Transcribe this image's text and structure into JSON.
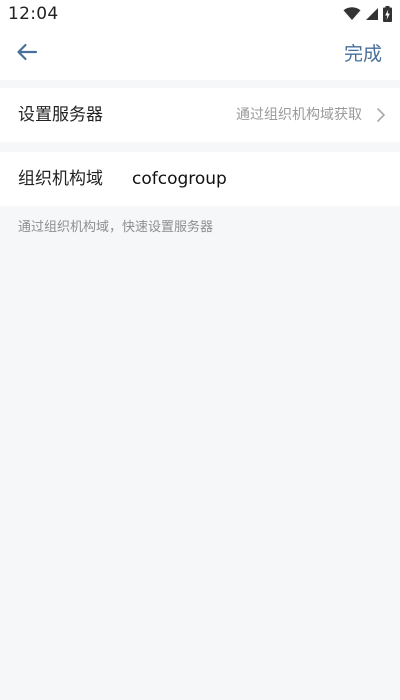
{
  "status_bar": {
    "time": "12:04",
    "icons": [
      "wifi-icon",
      "cellular-signal-icon",
      "battery-charging-icon"
    ]
  },
  "nav": {
    "back_icon": "arrow-left-icon",
    "done_label": "完成",
    "accent_color": "#4a6f9a"
  },
  "server_row": {
    "label": "设置服务器",
    "value": "通过组织机构域获取",
    "chevron_icon": "chevron-right-icon"
  },
  "domain_row": {
    "label": "组织机构域",
    "value": "cofcogroup"
  },
  "hint": "通过组织机构域，快速设置服务器"
}
